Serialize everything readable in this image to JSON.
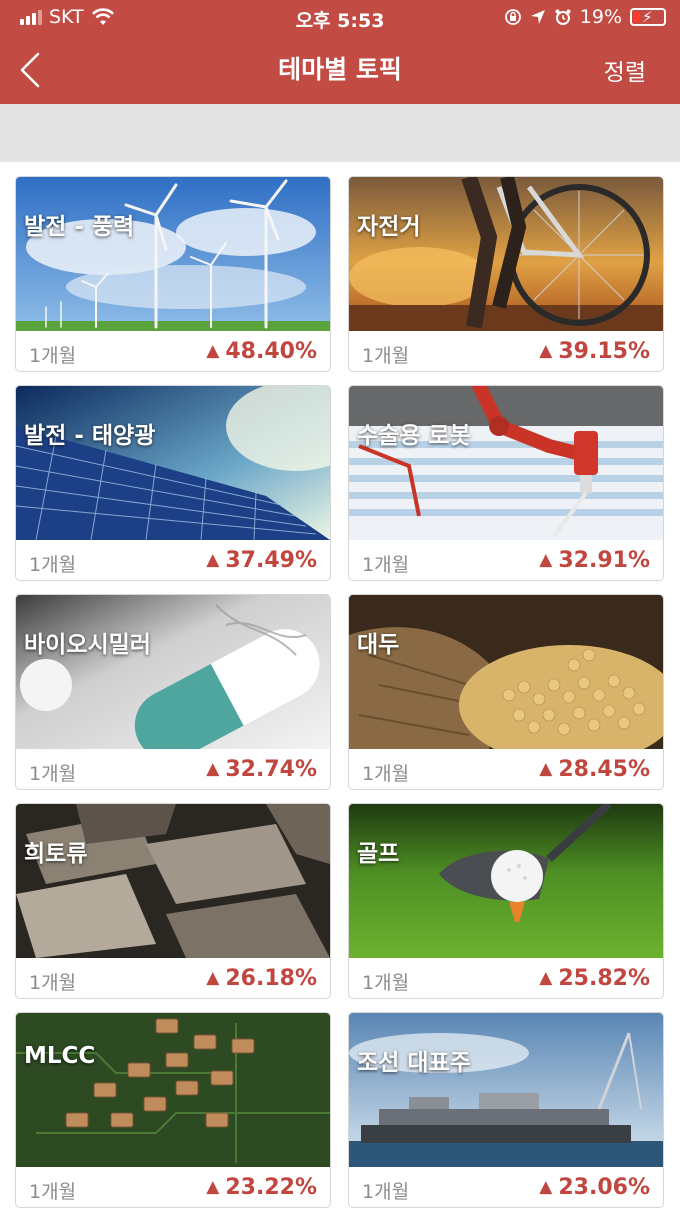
{
  "status_bar": {
    "carrier": "SKT",
    "time": "오후 5:53",
    "battery": "19%"
  },
  "nav": {
    "title": "테마별 토픽",
    "sort_label": "정렬"
  },
  "colors": {
    "brand": "#c24b43",
    "up": "#c0463f"
  },
  "themes": [
    {
      "title": "발전 - 풍력",
      "period": "1개월",
      "change": "48.40%",
      "direction": "up"
    },
    {
      "title": "자전거",
      "period": "1개월",
      "change": "39.15%",
      "direction": "up"
    },
    {
      "title": "발전 - 태양광",
      "period": "1개월",
      "change": "37.49%",
      "direction": "up"
    },
    {
      "title": "수술용 로봇",
      "period": "1개월",
      "change": "32.91%",
      "direction": "up"
    },
    {
      "title": "바이오시밀러",
      "period": "1개월",
      "change": "32.74%",
      "direction": "up"
    },
    {
      "title": "대두",
      "period": "1개월",
      "change": "28.45%",
      "direction": "up"
    },
    {
      "title": "희토류",
      "period": "1개월",
      "change": "26.18%",
      "direction": "up"
    },
    {
      "title": "골프",
      "period": "1개월",
      "change": "25.82%",
      "direction": "up"
    },
    {
      "title": "MLCC",
      "period": "1개월",
      "change": "23.22%",
      "direction": "up"
    },
    {
      "title": "조선 대표주",
      "period": "1개월",
      "change": "23.06%",
      "direction": "up"
    }
  ]
}
